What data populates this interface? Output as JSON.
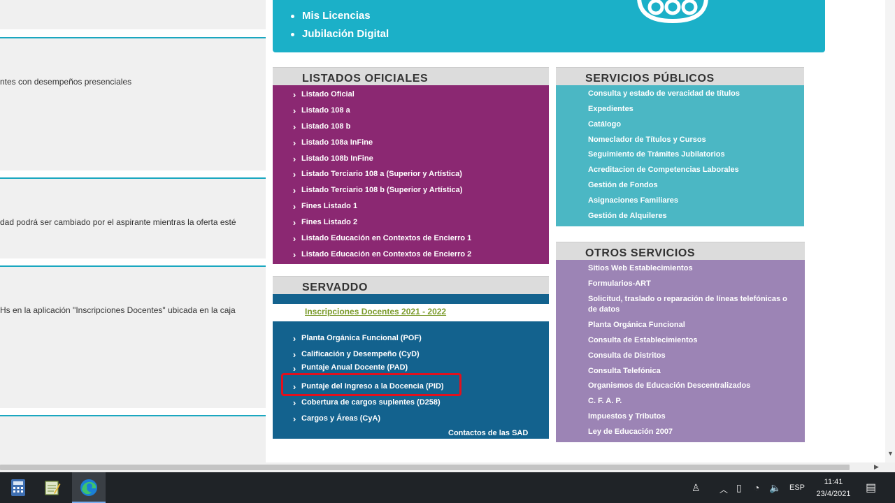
{
  "left_panels": [
    {
      "text": "ntes con desempeños presenciales"
    },
    {
      "text": "dad podrá ser cambiado por el aspirante mientras la oferta esté"
    },
    {
      "text": " Hs en la aplicación \"Inscripciones Docentes\" ubicada en la caja"
    }
  ],
  "top_banner": {
    "links": [
      "Mis Licencias",
      "Jubilación Digital"
    ],
    "logo_text": "abc"
  },
  "listados": {
    "title": "LISTADOS  OFICIALES",
    "items": [
      "Listado Oficial",
      "Listado 108 a",
      "Listado 108 b",
      "Listado 108a InFine",
      "Listado 108b InFine",
      "Listado Terciario 108 a (Superior y Artística)",
      "Listado Terciario 108 b (Superior y Artística)",
      "Fines Listado 1",
      "Fines Listado 2",
      "Listado Educación en Contextos de Encierro 1",
      "Listado Educación en Contextos de Encierro 2"
    ]
  },
  "servicios_publicos": {
    "title": "SERVICIOS  PÚBLICOS",
    "items": [
      "Consulta y estado de veracidad de títulos",
      "Expedientes",
      "Catálogo",
      "Nomeclador de Títulos y Cursos",
      "Seguimiento de Trámites Jubilatorios",
      "Acreditacion de Competencias Laborales",
      "Gestión de Fondos",
      "Asignaciones Familiares",
      "Gestión de Alquileres"
    ]
  },
  "servaddo": {
    "title": "SERVADDO",
    "inscripciones": "Inscripciones Docentes 2021 - 2022",
    "items": [
      "Planta Orgánica Funcional (POF)",
      "Calificación y Desempeño (CyD)",
      "Puntaje Anual Docente (PAD)",
      "Puntaje del Ingreso a la Docencia (PID)",
      "Cobertura de cargos suplentes (D258)",
      "Cargos y Áreas (CyA)"
    ],
    "contactos": "Contactos de las SAD"
  },
  "otros_servicios": {
    "title": "OTROS  SERVICIOS",
    "items": [
      "Sitios Web Establecimientos",
      "Formularios-ART",
      "Solicitud, traslado o reparación de líneas telefónicas o de datos",
      "Planta Orgánica Funcional",
      "Consulta de Establecimientos",
      "Consulta de Distritos",
      "Consulta Telefónica",
      "Organismos de Educación Descentralizados",
      "C. F. A. P.",
      "Impuestos y Tributos",
      "Ley de Educación 2007"
    ]
  },
  "taskbar": {
    "apps": [
      "calculator-icon",
      "notepad-icon",
      "edge-icon"
    ],
    "language": "ESP",
    "time": "11:41",
    "date": "23/4/2021"
  },
  "colors": {
    "cyan_banner": "#1bb0c8",
    "purple": "#8b2872",
    "teal": "#4bb7c4",
    "lilac": "#9c84b5",
    "navy": "#13628e",
    "highlight": "#e2101d"
  }
}
